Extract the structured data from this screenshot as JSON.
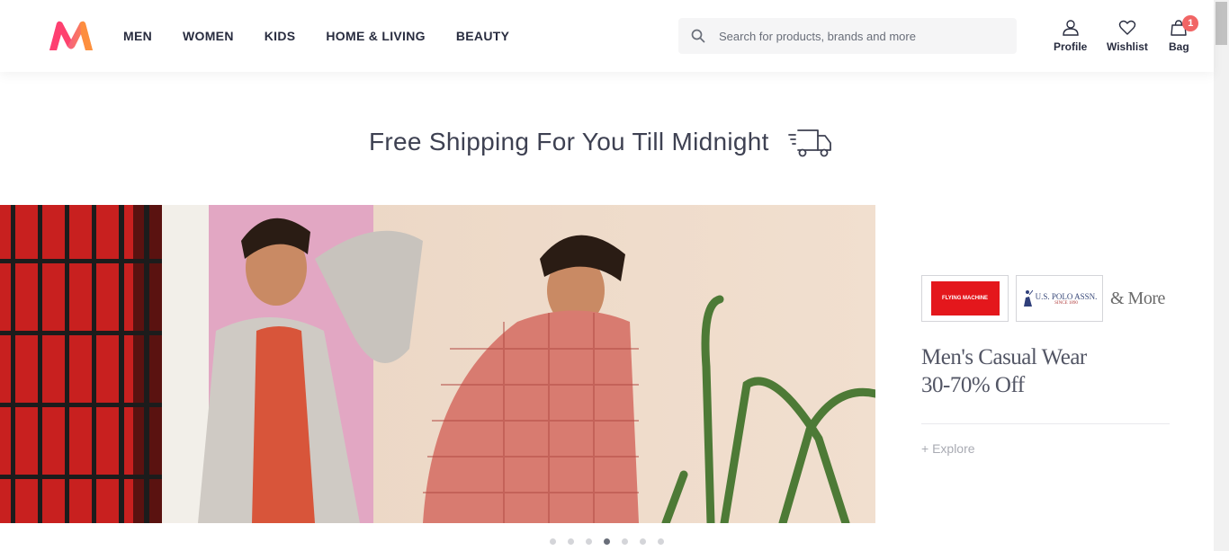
{
  "header": {
    "nav": [
      {
        "label": "MEN"
      },
      {
        "label": "WOMEN"
      },
      {
        "label": "KIDS"
      },
      {
        "label": "HOME & LIVING"
      },
      {
        "label": "BEAUTY"
      }
    ],
    "search": {
      "placeholder": "Search for products, brands and more",
      "value": ""
    },
    "actions": {
      "profile": "Profile",
      "wishlist": "Wishlist",
      "bag": "Bag",
      "bag_count": "1"
    }
  },
  "shipping_banner": {
    "text": "Free Shipping For You Till Midnight",
    "icon": "delivery-truck-icon"
  },
  "hero": {
    "brands": [
      {
        "name": "Flying Machine",
        "logo_text": "FLYING MACHINE"
      },
      {
        "name": "U.S. Polo Assn.",
        "logo_text": "U.S. POLO ASSN.",
        "logo_sub": "SINCE 1890"
      }
    ],
    "more_label": "& More",
    "title_line1": "Men's Casual Wear",
    "title_line2": "30-70% Off",
    "cta": "+ Explore"
  },
  "carousel": {
    "total": 7,
    "active_index": 3
  },
  "colors": {
    "brand_pink": "#ff3f6c",
    "badge": "#f16565",
    "text_dark": "#282c3f",
    "search_bg": "#f5f5f6"
  }
}
